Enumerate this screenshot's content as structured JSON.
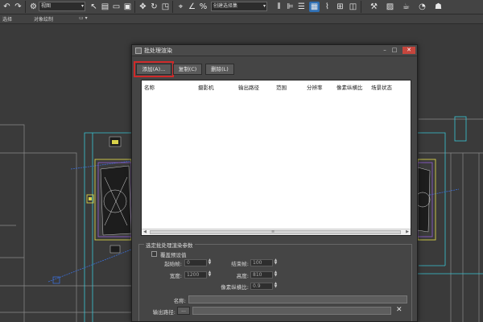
{
  "toolbar": {
    "selection_dropdown": "视图",
    "named_set_dropdown": "创建选择集",
    "icons": [
      "undo-icon",
      "redo-icon",
      "link-icon",
      "unlink-icon",
      "bind-spacewarp-icon",
      "select-filter-icon",
      "select-object-icon",
      "select-by-name-icon",
      "rect-select-icon",
      "window-crossing-icon",
      "move-icon",
      "rotate-icon",
      "scale-icon",
      "ref-coord-icon",
      "pivot-icon",
      "select-manipulate-icon",
      "keyboard-shortcut-icon",
      "snap-icon",
      "angle-snap-icon",
      "percent-snap-icon",
      "spinner-snap-icon",
      "named-sets-icon",
      "mirror-icon",
      "align-icon",
      "layer-icon",
      "graphite-icon",
      "curve-editor-icon",
      "schematic-icon",
      "material-editor-icon",
      "render-setup-icon",
      "render-frame-icon",
      "render-icon"
    ]
  },
  "ribbon": {
    "label_1": "选择",
    "label_2": "对象绘制"
  },
  "dialog": {
    "title": "批处理渲染",
    "add_button": "添加(A)...",
    "copy_button": "复制(C)",
    "delete_button": "删除(L)",
    "columns": [
      "名称",
      "摄影机",
      "输出路径",
      "范围",
      "分辨率",
      "像素纵横比",
      "场景状态"
    ],
    "group_label": "选定批处理渲染参数",
    "override_label": "覆盖预设值",
    "start_frame_label": "起始帧:",
    "start_frame_value": "0",
    "end_frame_label": "结束帧:",
    "end_frame_value": "100",
    "width_label": "宽度:",
    "width_value": "1200",
    "height_label": "高度:",
    "height_value": "810",
    "pixel_aspect_label": "像素纵横比:",
    "pixel_aspect_value": "0.9",
    "name_label": "名称:",
    "name_value": "",
    "output_path_label": "输出路径:",
    "browse_label": "...",
    "clear_icon": "x-icon"
  },
  "colors": {
    "highlight": "#d02a2a",
    "close_button": "#c6463d",
    "viewport_bg": "#3a3a3a",
    "cyan_lines": "#39c6d6",
    "yellow_lines": "#d9d24a",
    "purple_lines": "#8a5cc7"
  }
}
